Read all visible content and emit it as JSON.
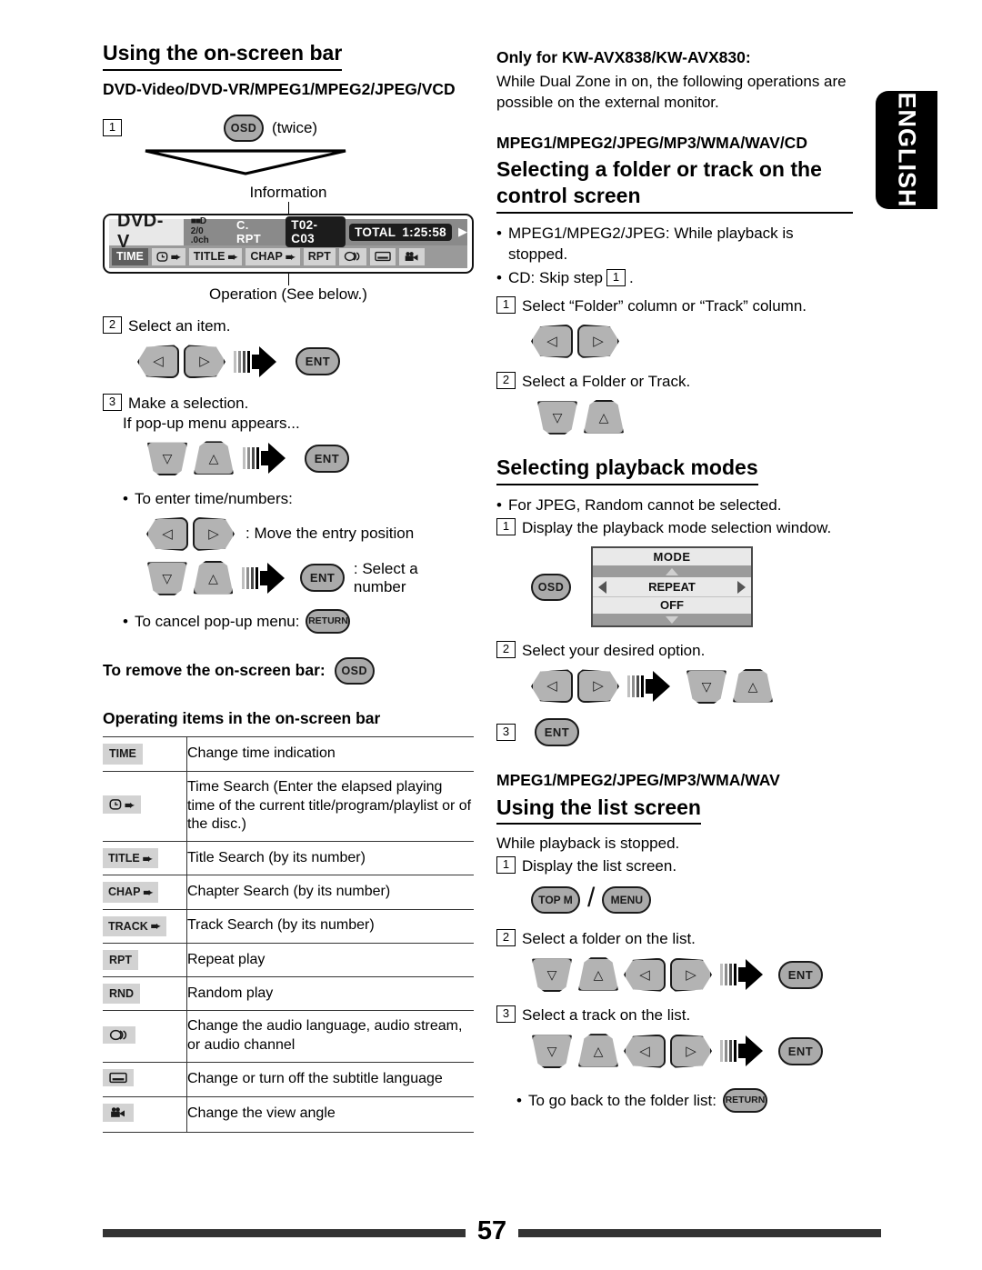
{
  "page_number": "57",
  "language_tab": "ENGLISH",
  "left_column": {
    "heading": "Using the on-screen bar",
    "formats": "DVD-Video/DVD-VR/MPEG1/MPEG2/JPEG/VCD",
    "step1": {
      "number": "1",
      "button": "OSD",
      "note": "(twice)"
    },
    "callout_information": "Information",
    "callout_operation": "Operation (See below.)",
    "onscreen_bar": {
      "disc_type": "DVD-V",
      "audio_format_line1": "D",
      "audio_format_line2": "2/0 .0ch",
      "repeat_status": "C. RPT",
      "title_chapter": "T02-C03",
      "time_label": "TOTAL",
      "time_value": "1:25:58",
      "caret": "▶",
      "items": [
        {
          "label": "TIME",
          "selected": true,
          "arrow": false,
          "icon": ""
        },
        {
          "label": "",
          "selected": false,
          "arrow": true,
          "icon": "clock-icon"
        },
        {
          "label": "TITLE",
          "selected": false,
          "arrow": true,
          "icon": ""
        },
        {
          "label": "CHAP",
          "selected": false,
          "arrow": true,
          "icon": ""
        },
        {
          "label": "RPT",
          "selected": false,
          "arrow": false,
          "icon": ""
        },
        {
          "label": "",
          "selected": false,
          "arrow": false,
          "icon": "audio-icon"
        },
        {
          "label": "",
          "selected": false,
          "arrow": false,
          "icon": "subtitle-icon"
        },
        {
          "label": "",
          "selected": false,
          "arrow": false,
          "icon": "angle-icon"
        }
      ]
    },
    "step2": {
      "number": "2",
      "text": "Select an item.",
      "ent": "ENT"
    },
    "step3": {
      "number": "3",
      "text": "Make a selection.",
      "subtext": "If pop-up menu appears...",
      "ent": "ENT"
    },
    "time_numbers_bullet": "To enter time/numbers:",
    "move_entry": ": Move the entry position",
    "select_number": ": Select a number",
    "cancel_popup": "To cancel pop-up menu:",
    "cancel_popup_button": "RETURN",
    "remove_bar": "To remove the on-screen bar:",
    "remove_bar_button": "OSD",
    "table_heading": "Operating items in the on-screen bar",
    "table_rows": [
      {
        "icon_label": "TIME",
        "icon_type": "text",
        "arrow": false,
        "description": "Change time indication"
      },
      {
        "icon_label": "",
        "icon_type": "clock-icon",
        "arrow": true,
        "description": "Time Search (Enter the elapsed playing time of the current title/program/playlist or of the disc.)"
      },
      {
        "icon_label": "TITLE",
        "icon_type": "text",
        "arrow": true,
        "description": "Title Search (by its number)"
      },
      {
        "icon_label": "CHAP",
        "icon_type": "text",
        "arrow": true,
        "description": "Chapter Search (by its number)"
      },
      {
        "icon_label": "TRACK",
        "icon_type": "text",
        "arrow": true,
        "description": "Track Search (by its number)"
      },
      {
        "icon_label": "RPT",
        "icon_type": "text",
        "arrow": false,
        "description": "Repeat play"
      },
      {
        "icon_label": "RND",
        "icon_type": "text",
        "arrow": false,
        "description": "Random play"
      },
      {
        "icon_label": "",
        "icon_type": "audio-icon",
        "arrow": false,
        "description": "Change the audio language, audio stream, or audio channel"
      },
      {
        "icon_label": "",
        "icon_type": "subtitle-icon",
        "arrow": false,
        "description": "Change or turn off the subtitle language"
      },
      {
        "icon_label": "",
        "icon_type": "angle-icon",
        "arrow": false,
        "description": "Change the view angle"
      }
    ]
  },
  "right_column": {
    "note_heading": "Only for KW-AVX838/KW-AVX830:",
    "note_body": "While Dual Zone in on, the following operations are possible on the external monitor.",
    "formats_control": "MPEG1/MPEG2/JPEG/MP3/WMA/WAV/CD",
    "heading_control": "Selecting a folder or track on the control screen",
    "bullet_mpeg": "MPEG1/MPEG2/JPEG: While playback is stopped.",
    "bullet_cd_pre": "CD: Skip step",
    "bullet_cd_step": "1",
    "bullet_cd_post": ".",
    "step1": {
      "number": "1",
      "text": "Select “Folder” column or “Track” column."
    },
    "step2": {
      "number": "2",
      "text": "Select a Folder or Track."
    },
    "heading_playback": "Selecting playback modes",
    "bullet_jpeg": "For JPEG, Random cannot be selected.",
    "pb_step1": {
      "number": "1",
      "text": "Display the playback mode selection window.",
      "button": "OSD"
    },
    "mode_window": {
      "title": "MODE",
      "option": "REPEAT",
      "value": "OFF"
    },
    "pb_step2": {
      "number": "2",
      "text": "Select your desired option."
    },
    "pb_step3": {
      "number": "3",
      "button": "ENT"
    },
    "formats_list": "MPEG1/MPEG2/JPEG/MP3/WMA/WAV",
    "heading_list": "Using the list screen",
    "list_intro": "While playback is stopped.",
    "list_step1": {
      "number": "1",
      "text": "Display the list screen.",
      "button_a": "TOP M",
      "button_b": "MENU"
    },
    "list_step2": {
      "number": "2",
      "text": "Select a folder on the list.",
      "ent": "ENT"
    },
    "list_step3": {
      "number": "3",
      "text": "Select a track on the list.",
      "ent": "ENT"
    },
    "go_back": "To go back to the folder list:",
    "go_back_button": "RETURN"
  }
}
